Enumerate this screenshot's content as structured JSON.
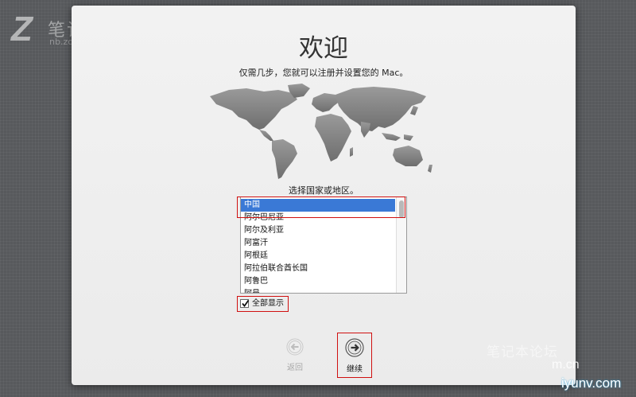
{
  "watermark": {
    "logo_letter": "Z",
    "site_name": "笔记本论坛",
    "site_url": "nb.zol.com.cn/forum.cn",
    "bottom_right_text": "笔记本论坛",
    "bottom_right_domain": "m.cn",
    "bottom_right_site": "iyunv.com"
  },
  "window": {
    "title": "欢迎",
    "subtitle": "仅需几步，您就可以注册并设置您的 Mac。",
    "prompt": "选择国家或地区。"
  },
  "country_list": {
    "items": [
      {
        "label": "中国",
        "selected": true
      },
      {
        "label": "阿尔巴尼亚",
        "selected": false
      },
      {
        "label": "阿尔及利亚",
        "selected": false
      },
      {
        "label": "阿富汗",
        "selected": false
      },
      {
        "label": "阿根廷",
        "selected": false
      },
      {
        "label": "阿拉伯联合酋长国",
        "selected": false
      },
      {
        "label": "阿鲁巴",
        "selected": false
      },
      {
        "label": "阿曼",
        "selected": false
      }
    ]
  },
  "show_all": {
    "label": "全部显示",
    "checked": true
  },
  "buttons": {
    "back_label": "返回",
    "back_icon": "arrow-left-circle-icon",
    "continue_label": "继续",
    "continue_icon": "arrow-right-circle-icon"
  },
  "colors": {
    "selection": "#3a79d6",
    "annotation_frame": "#d01010"
  }
}
